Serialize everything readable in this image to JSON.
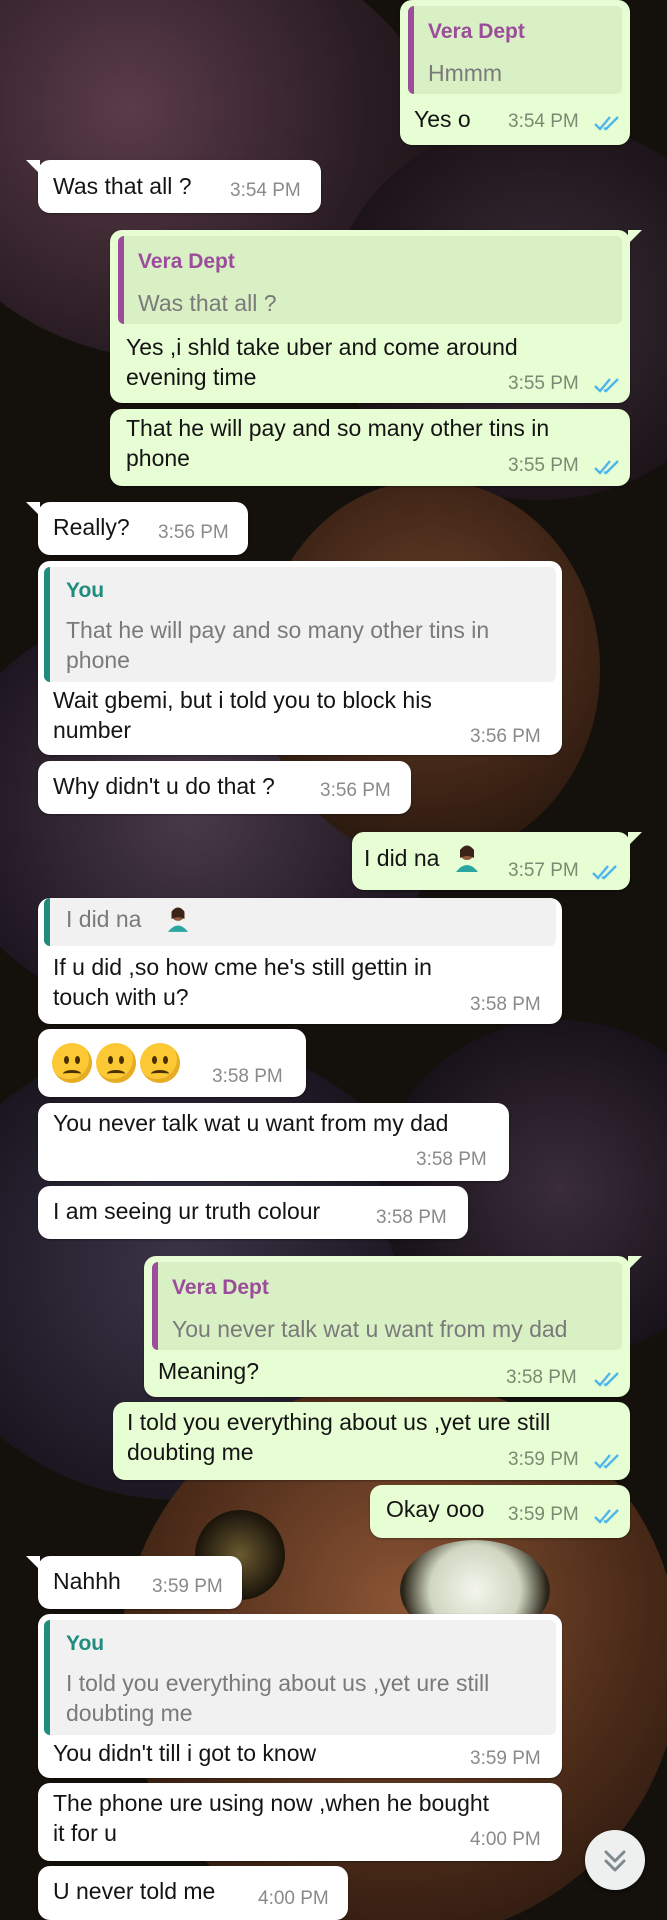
{
  "colors": {
    "incoming_bubble": "#ffffff",
    "outgoing_bubble": "#e7fdd3",
    "quote_outgoing_bar": "#9b4d9c",
    "quote_incoming_bar": "#1f8c7e",
    "read_ticks": "#4fb6ec",
    "wallpaper": "#14100c"
  },
  "icons": {
    "read_receipt": "double-check-icon",
    "scroll_down": "double-chevron-down-icon",
    "emoji_person": "person-tipping-hand-emoji",
    "emoji_confused": "confused-face-emoji"
  },
  "messages": [
    {
      "id": 1,
      "dir": "out",
      "quote": {
        "name": "Vera Dept",
        "lines": [
          "Hmmm"
        ]
      },
      "lines": [
        "Yes o"
      ],
      "time": "3:54 PM",
      "read": true
    },
    {
      "id": 2,
      "dir": "in",
      "lines": [
        "Was that all ?"
      ],
      "time": "3:54 PM"
    },
    {
      "id": 3,
      "dir": "out",
      "quote": {
        "name": "Vera Dept",
        "lines": [
          "Was that all ?"
        ]
      },
      "lines": [
        "Yes ,i shld take uber and come around",
        "evening time"
      ],
      "time": "3:55 PM",
      "read": true
    },
    {
      "id": 4,
      "dir": "out",
      "lines": [
        "That he will pay and so many other tins in",
        "phone"
      ],
      "time": "3:55 PM",
      "read": true
    },
    {
      "id": 5,
      "dir": "in",
      "lines": [
        "Really?"
      ],
      "time": "3:56 PM"
    },
    {
      "id": 6,
      "dir": "in",
      "quote": {
        "name": "You",
        "lines": [
          "That he will pay and so many other tins in",
          "phone"
        ]
      },
      "lines": [
        "Wait gbemi, but i told you to block his",
        "number"
      ],
      "time": "3:56 PM"
    },
    {
      "id": 7,
      "dir": "in",
      "lines": [
        "Why didn't u do that ?"
      ],
      "time": "3:56 PM"
    },
    {
      "id": 8,
      "dir": "out",
      "lines": [
        "I did na"
      ],
      "time": "3:57 PM",
      "read": true
    },
    {
      "id": 9,
      "dir": "in",
      "quote": {
        "name": "",
        "lines": [
          "I did na"
        ]
      },
      "lines": [
        "If u did ,so how cme he's still gettin in",
        "touch with u?"
      ],
      "time": "3:58 PM"
    },
    {
      "id": 10,
      "dir": "in",
      "lines": [
        ""
      ],
      "time": "3:58 PM"
    },
    {
      "id": 11,
      "dir": "in",
      "lines": [
        "You never talk wat u want from my dad"
      ],
      "time": "3:58 PM"
    },
    {
      "id": 12,
      "dir": "in",
      "lines": [
        "I am seeing ur truth colour"
      ],
      "time": "3:58 PM"
    },
    {
      "id": 13,
      "dir": "out",
      "quote": {
        "name": "Vera Dept",
        "lines": [
          "You never talk wat u want from my dad"
        ]
      },
      "lines": [
        "Meaning?"
      ],
      "time": "3:58 PM",
      "read": true
    },
    {
      "id": 14,
      "dir": "out",
      "lines": [
        "I told you everything about us ,yet ure still",
        "doubting me"
      ],
      "time": "3:59 PM",
      "read": true
    },
    {
      "id": 15,
      "dir": "out",
      "lines": [
        "Okay ooo"
      ],
      "time": "3:59 PM",
      "read": true
    },
    {
      "id": 16,
      "dir": "in",
      "lines": [
        "Nahhh"
      ],
      "time": "3:59 PM"
    },
    {
      "id": 17,
      "dir": "in",
      "quote": {
        "name": "You",
        "lines": [
          "I told you everything about us ,yet ure still",
          "doubting me"
        ]
      },
      "lines": [
        "You didn't till i got to know"
      ],
      "time": "3:59 PM"
    },
    {
      "id": 18,
      "dir": "in",
      "lines": [
        "The phone ure using now ,when he bought",
        "it for u"
      ],
      "time": "4:00 PM"
    },
    {
      "id": 19,
      "dir": "in",
      "lines": [
        "U never told me"
      ],
      "time": "4:00 PM"
    }
  ]
}
